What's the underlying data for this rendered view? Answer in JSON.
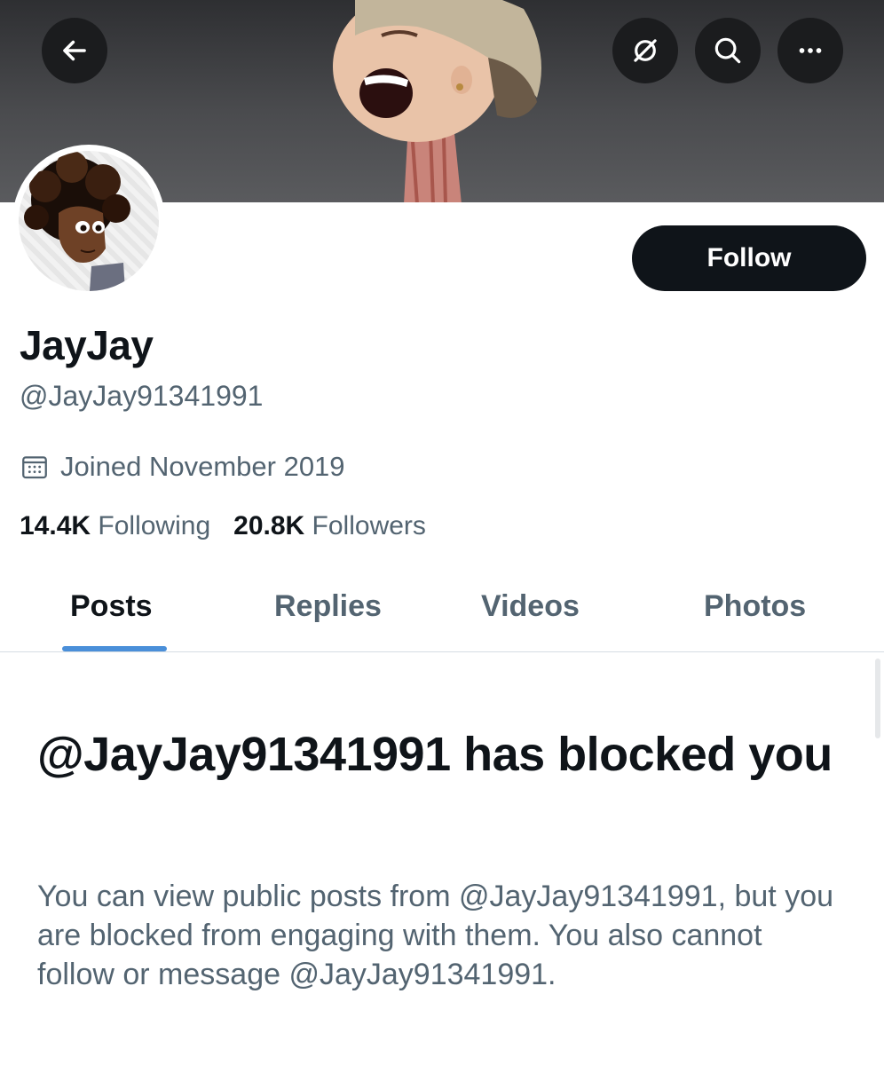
{
  "header": {
    "back_icon": "arrow-left-icon",
    "actions": [
      "lightning-off-icon",
      "search-icon",
      "more-icon"
    ]
  },
  "profile": {
    "display_name": "JayJay",
    "handle": "@JayJay91341991",
    "joined": "Joined November 2019",
    "following_count": "14.4K",
    "following_label": "Following",
    "followers_count": "20.8K",
    "followers_label": "Followers",
    "follow_label": "Follow"
  },
  "tabs": [
    {
      "label": "Posts",
      "active": true
    },
    {
      "label": "Replies",
      "active": false
    },
    {
      "label": "Videos",
      "active": false
    },
    {
      "label": "Photos",
      "active": false
    }
  ],
  "blocked": {
    "title": "@JayJay91341991 has blocked you",
    "description": "You can view public posts from @JayJay91341991, but you are blocked from engaging with them. You also cannot follow or message @JayJay91341991."
  },
  "colors": {
    "accent": "#1d9bf0",
    "text_primary": "#0f1419",
    "text_secondary": "#536471"
  }
}
